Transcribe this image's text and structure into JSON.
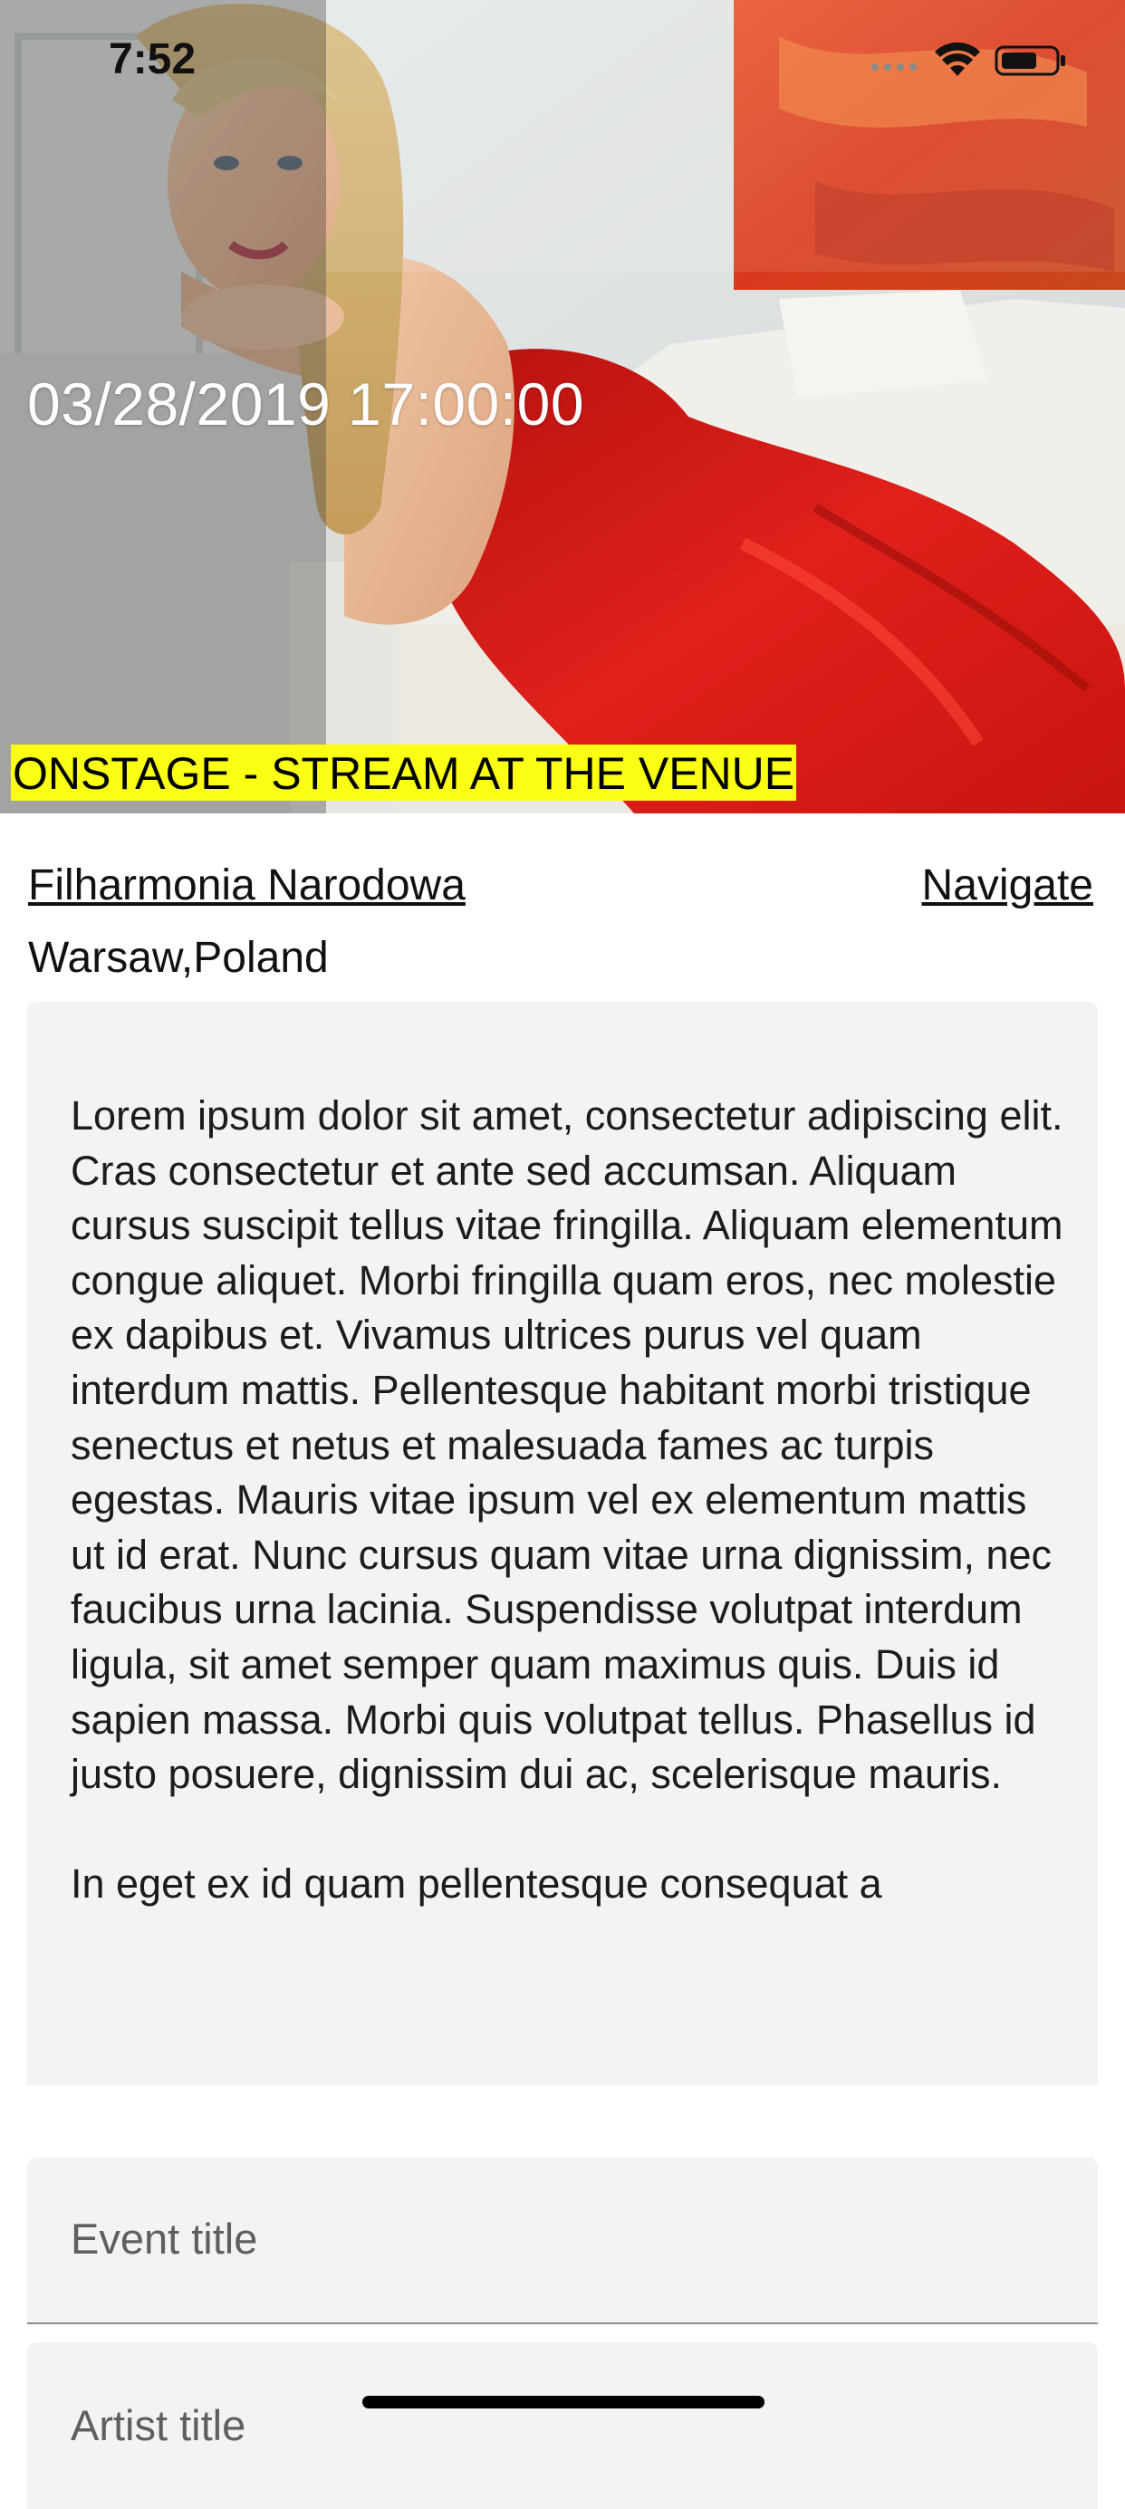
{
  "status_bar": {
    "time": "7:52",
    "icons": [
      "signal-icon",
      "wifi-icon",
      "battery-icon"
    ]
  },
  "hero": {
    "image": "performer-portrait-red-dress",
    "datetime": "03/28/2019 17:00:00",
    "stream_badge": "ONSTAGE - STREAM AT THE VENUE",
    "badge_color": "#fbff13"
  },
  "venue": {
    "name": "Filharmonia Narodowa",
    "navigate_label": "Navigate",
    "city": "Warsaw,Poland"
  },
  "description": {
    "text": "Lorem ipsum dolor sit amet, consectetur adipiscing elit. Cras consectetur et ante sed accumsan. Aliquam cursus suscipit tellus vitae fringilla. Aliquam elementum congue aliquet. Morbi fringilla quam eros, nec molestie ex dapibus et. Vivamus ultrices purus vel quam interdum mattis. Pellentesque habitant morbi tristique senectus et netus et malesuada fames ac turpis egestas. Mauris vitae ipsum vel ex elementum mattis ut id erat. Nunc cursus quam vitae urna dignissim, nec faucibus urna lacinia. Suspendisse volutpat interdum ligula, sit amet semper quam maximus quis. Duis id sapien massa. Morbi quis volutpat tellus. Phasellus id justo posuere, dignissim dui ac, scelerisque mauris.\n\nIn eget ex id quam pellentesque consequat a"
  },
  "form": {
    "event_title_label": "Event title",
    "artist_title_label": "Artist title"
  }
}
